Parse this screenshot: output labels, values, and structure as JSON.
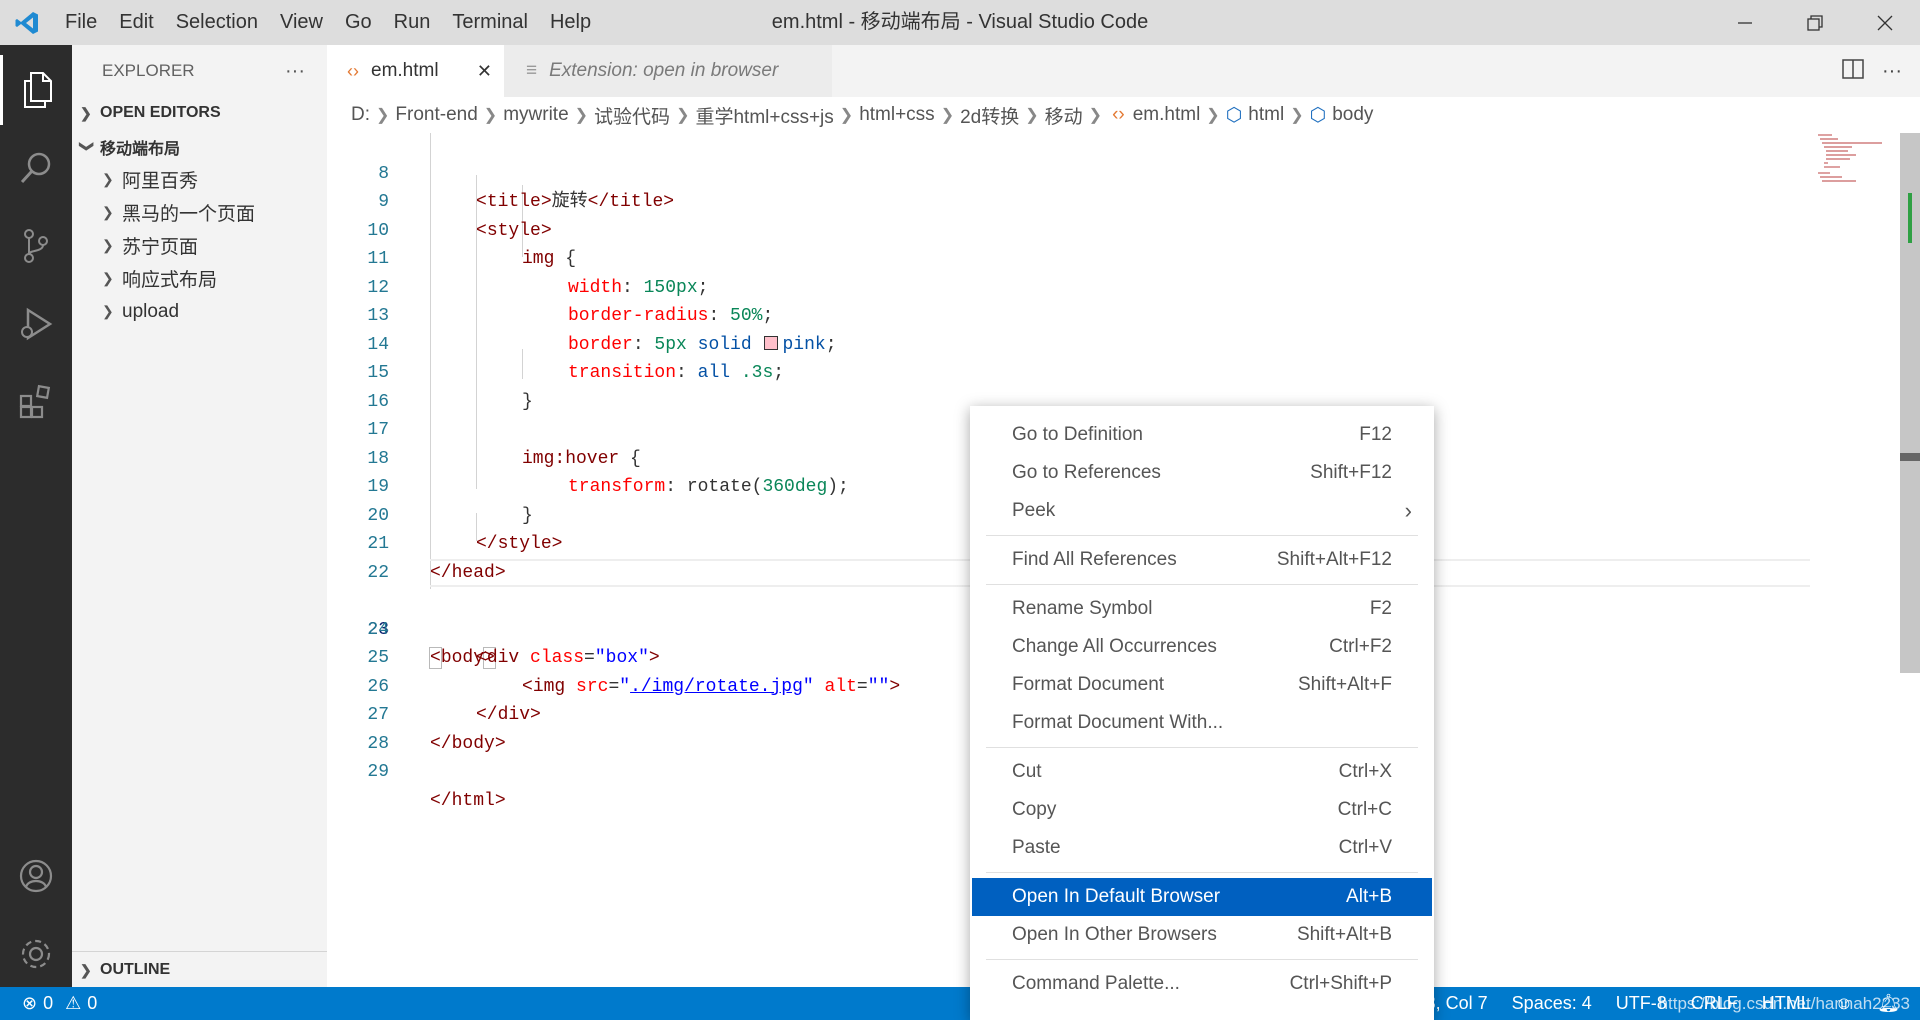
{
  "window": {
    "title": "em.html - 移动端布局 - Visual Studio Code",
    "menu": [
      "File",
      "Edit",
      "Selection",
      "View",
      "Go",
      "Run",
      "Terminal",
      "Help"
    ]
  },
  "sidebar": {
    "title": "EXPLORER",
    "open_editors": "OPEN EDITORS",
    "folder": "移动端布局",
    "items": [
      "阿里百秀",
      "黑马的一个页面",
      "苏宁页面",
      "响应式布局",
      "upload"
    ],
    "outline": "OUTLINE"
  },
  "tabs": {
    "active": "em.html",
    "inactive": "Extension: open in browser"
  },
  "breadcrumb": [
    "D:",
    "Front-end",
    "mywrite",
    "试验代码",
    "重学html+css+js",
    "html+css",
    "2d转换",
    "移动",
    "em.html",
    "html",
    "body"
  ],
  "editor": {
    "line_numbers": [
      "8",
      "9",
      "10",
      "11",
      "12",
      "13",
      "14",
      "15",
      "16",
      "17",
      "18",
      "19",
      "20",
      "21",
      "22",
      "23",
      "24",
      "25",
      "26",
      "27",
      "28",
      "29"
    ],
    "current_line": "23",
    "title_text": "旋转",
    "img_selector": "img",
    "hover_selector": "img:hover",
    "width_value": "150px",
    "radius_value": "50%",
    "border_value": "5px",
    "border_style": "solid",
    "border_color": "pink",
    "transition_value": "all",
    "transition_time": ".3s",
    "rotate_value": "360deg",
    "div_class": "\"box\"",
    "img_src": "./img/rotate.jpg",
    "img_alt": "\"\""
  },
  "context_menu": {
    "items": [
      {
        "label": "Go to Definition",
        "key": "F12"
      },
      {
        "label": "Go to References",
        "key": "Shift+F12"
      },
      {
        "label": "Peek",
        "key": "›"
      },
      {
        "label": "Find All References",
        "key": "Shift+Alt+F12"
      },
      {
        "label": "Rename Symbol",
        "key": "F2"
      },
      {
        "label": "Change All Occurrences",
        "key": "Ctrl+F2"
      },
      {
        "label": "Format Document",
        "key": "Shift+Alt+F"
      },
      {
        "label": "Format Document With...",
        "key": ""
      },
      {
        "label": "Cut",
        "key": "Ctrl+X"
      },
      {
        "label": "Copy",
        "key": "Ctrl+C"
      },
      {
        "label": "Paste",
        "key": "Ctrl+V"
      },
      {
        "label": "Open In Default Browser",
        "key": "Alt+B"
      },
      {
        "label": "Open In Other Browsers",
        "key": "Shift+Alt+B"
      },
      {
        "label": "Command Palette...",
        "key": "Ctrl+Shift+P"
      }
    ]
  },
  "statusbar": {
    "errors": "0",
    "warnings": "0",
    "position": "23, Col 7",
    "spaces": "Spaces: 4",
    "encoding": "UTF-8",
    "eol": "CRLF",
    "language": "HTML",
    "watermark": "https://blog.csdn.net/hannah2233"
  },
  "colors": {
    "accent": "#007acc",
    "menu_highlight": "#0060c0",
    "activity_bar": "#2c2c2c"
  }
}
